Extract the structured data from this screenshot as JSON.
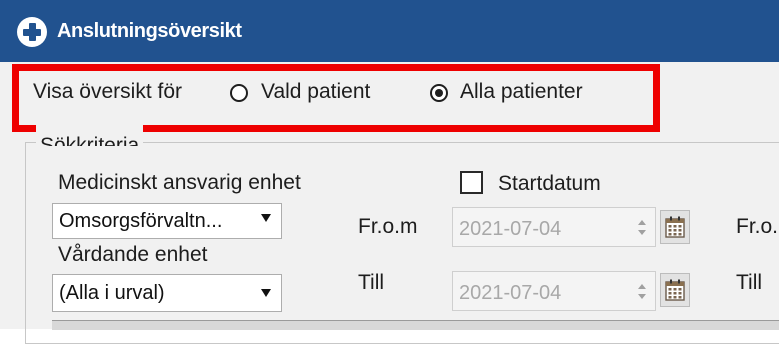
{
  "window": {
    "title": "Anslutningsöversikt",
    "app_icon": "plus-circle-icon"
  },
  "overview": {
    "label": "Visa översikt för",
    "options": [
      {
        "label": "Vald patient",
        "checked": false
      },
      {
        "label": "Alla patienter",
        "checked": true
      }
    ]
  },
  "criteria": {
    "legend": "Sökkriteria",
    "medical_unit": {
      "label": "Medicinskt ansvarig enhet",
      "selected": "Omsorgsförvaltn..."
    },
    "care_unit": {
      "label": "Vårdande enhet",
      "selected": "(Alla i urval)"
    },
    "startdate": {
      "label": "Startdatum",
      "checked": false
    },
    "from": {
      "label": "Fr.o.m",
      "value": "2021-07-04"
    },
    "to": {
      "label": "Till",
      "value": "2021-07-04"
    },
    "right_from_label": "Fr.o.",
    "right_to_label": "Till"
  },
  "colors": {
    "titlebar": "#21528f",
    "highlight": "#ee0000",
    "panel": "#f1f1f1"
  }
}
